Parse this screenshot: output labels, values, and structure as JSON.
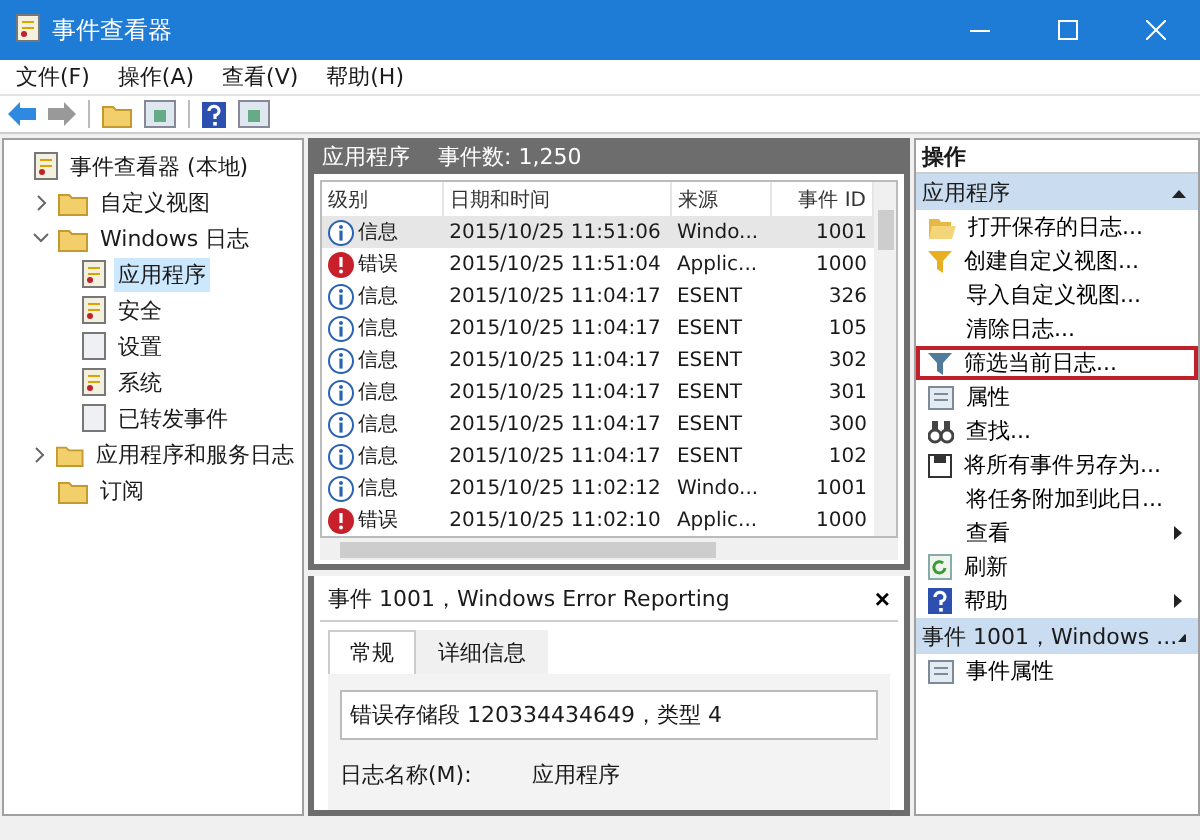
{
  "window": {
    "title": "事件查看器"
  },
  "menu": [
    "文件(F)",
    "操作(A)",
    "查看(V)",
    "帮助(H)"
  ],
  "tree": [
    {
      "label": "事件查看器 (本地)",
      "kind": "log",
      "selected": false,
      "children": [
        {
          "label": "自定义视图",
          "kind": "folder",
          "selected": false,
          "expanded": false
        },
        {
          "label": "Windows 日志",
          "kind": "folder",
          "selected": false,
          "expanded": true,
          "children": [
            {
              "label": "应用程序",
              "kind": "log",
              "selected": true
            },
            {
              "label": "安全",
              "kind": "log",
              "selected": false
            },
            {
              "label": "设置",
              "kind": "page",
              "selected": false
            },
            {
              "label": "系统",
              "kind": "log",
              "selected": false
            },
            {
              "label": "已转发事件",
              "kind": "page",
              "selected": false
            }
          ]
        },
        {
          "label": "应用程序和服务日志",
          "kind": "folder",
          "selected": false,
          "expanded": false
        },
        {
          "label": "订阅",
          "kind": "folder",
          "selected": false
        }
      ]
    }
  ],
  "log_header": {
    "name": "应用程序",
    "count": "事件数: 1,250"
  },
  "table": {
    "columns": [
      "级别",
      "日期和时间",
      "来源",
      "事件 ID"
    ],
    "rows": [
      {
        "kind": "info",
        "level": "信息",
        "date": "2015/10/25 11:51:06",
        "source": "Windo...",
        "id": "1001",
        "selected": true
      },
      {
        "kind": "error",
        "level": "错误",
        "date": "2015/10/25 11:51:04",
        "source": "Applic...",
        "id": "1000",
        "selected": false
      },
      {
        "kind": "info",
        "level": "信息",
        "date": "2015/10/25 11:04:17",
        "source": "ESENT",
        "id": "326",
        "selected": false
      },
      {
        "kind": "info",
        "level": "信息",
        "date": "2015/10/25 11:04:17",
        "source": "ESENT",
        "id": "105",
        "selected": false
      },
      {
        "kind": "info",
        "level": "信息",
        "date": "2015/10/25 11:04:17",
        "source": "ESENT",
        "id": "302",
        "selected": false
      },
      {
        "kind": "info",
        "level": "信息",
        "date": "2015/10/25 11:04:17",
        "source": "ESENT",
        "id": "301",
        "selected": false
      },
      {
        "kind": "info",
        "level": "信息",
        "date": "2015/10/25 11:04:17",
        "source": "ESENT",
        "id": "300",
        "selected": false
      },
      {
        "kind": "info",
        "level": "信息",
        "date": "2015/10/25 11:04:17",
        "source": "ESENT",
        "id": "102",
        "selected": false
      },
      {
        "kind": "info",
        "level": "信息",
        "date": "2015/10/25 11:02:12",
        "source": "Windo...",
        "id": "1001",
        "selected": false
      },
      {
        "kind": "error",
        "level": "错误",
        "date": "2015/10/25 11:02:10",
        "source": "Applic...",
        "id": "1000",
        "selected": false
      }
    ]
  },
  "detail": {
    "title": "事件 1001，Windows Error Reporting",
    "close": "×",
    "tabs": [
      {
        "label": "常规",
        "selected": true
      },
      {
        "label": "详细信息",
        "selected": false
      }
    ],
    "message": "错误存储段 120334434649，类型 4",
    "field_label": "日志名称(M):",
    "field_value": "应用程序"
  },
  "actions": {
    "title": "操作",
    "sections": [
      {
        "title": "应用程序",
        "items": [
          {
            "label": "打开保存的日志...",
            "kind": "open",
            "submenu": false,
            "highlighted": false
          },
          {
            "label": "创建自定义视图...",
            "kind": "filter",
            "submenu": false,
            "highlighted": false
          },
          {
            "label": "导入自定义视图...",
            "kind": "plain",
            "submenu": false,
            "highlighted": false
          },
          {
            "label": "清除日志...",
            "kind": "plain",
            "submenu": false,
            "highlighted": false
          },
          {
            "label": "筛选当前日志...",
            "kind": "filter-gray",
            "submenu": false,
            "highlighted": true
          },
          {
            "label": "属性",
            "kind": "properties",
            "submenu": false,
            "highlighted": false
          },
          {
            "label": "查找...",
            "kind": "find",
            "submenu": false,
            "highlighted": false
          },
          {
            "label": "将所有事件另存为...",
            "kind": "save",
            "submenu": false,
            "highlighted": false
          },
          {
            "label": "将任务附加到此日...",
            "kind": "plain",
            "submenu": false,
            "highlighted": false
          },
          {
            "label": "查看",
            "kind": "plain",
            "submenu": true,
            "highlighted": false
          },
          {
            "label": "刷新",
            "kind": "refresh",
            "submenu": false,
            "highlighted": false
          },
          {
            "label": "帮助",
            "kind": "help",
            "submenu": true,
            "highlighted": false
          }
        ]
      },
      {
        "title": "事件 1001，Windows ...",
        "items": [
          {
            "label": "事件属性",
            "kind": "properties",
            "submenu": false,
            "highlighted": false
          }
        ]
      }
    ]
  }
}
